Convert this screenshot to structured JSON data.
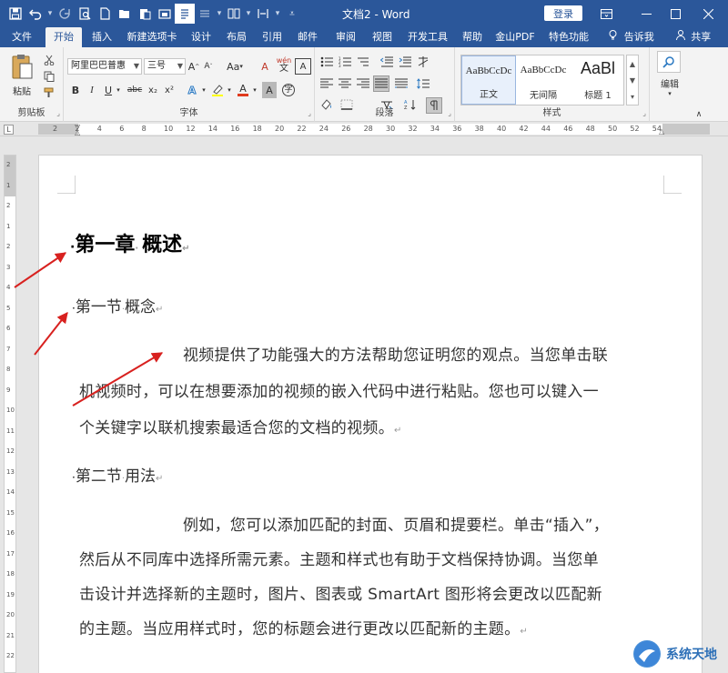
{
  "window": {
    "doc_title": "文档2 - Word",
    "login_label": "登录",
    "controls": [
      "ribbon-display",
      "minimize",
      "maximize",
      "close"
    ]
  },
  "quick_access": [
    "save",
    "undo",
    "redo",
    "print-preview",
    "new",
    "open",
    "paste",
    "screenshot",
    "read-mode",
    "layout",
    "columns",
    "spacing",
    "more"
  ],
  "tabs": [
    "文件",
    "开始",
    "插入",
    "新建选项卡",
    "设计",
    "布局",
    "引用",
    "邮件",
    "审阅",
    "视图",
    "开发工具",
    "帮助",
    "金山PDF",
    "特色功能",
    "告诉我",
    "共享"
  ],
  "active_tab": "开始",
  "ribbon": {
    "clipboard": {
      "label": "剪贴板",
      "paste": "粘贴"
    },
    "font": {
      "label": "字体",
      "font_name": "阿里巴巴普惠",
      "font_size": "三号",
      "buttons": [
        "B",
        "I",
        "U",
        "abc",
        "x₂",
        "x²",
        "A",
        "A",
        "A",
        "A"
      ],
      "change_case": "Aa",
      "clear_format": "A",
      "phonetic": "wén",
      "enclose": "A"
    },
    "paragraph": {
      "label": "段落"
    },
    "styles": {
      "label": "样式",
      "items": [
        {
          "preview": "AaBbCcDc",
          "name": "正文"
        },
        {
          "preview": "AaBbCcDc",
          "name": "无间隔"
        },
        {
          "preview": "AaBl",
          "name": "标题 1"
        }
      ]
    },
    "editing": {
      "label": "编辑"
    }
  },
  "ruler": {
    "corner": "L",
    "ticks": [
      "2",
      "2",
      "4",
      "6",
      "8",
      "10",
      "12",
      "14",
      "16",
      "18",
      "20",
      "22",
      "24",
      "26",
      "28",
      "30",
      "32",
      "34",
      "36",
      "38",
      "40",
      "42",
      "44",
      "46",
      "48",
      "50",
      "52",
      "54"
    ],
    "vticks": [
      "2",
      "1",
      "2",
      "1",
      "2",
      "3",
      "4",
      "5",
      "6",
      "7",
      "8",
      "9",
      "10",
      "11",
      "12",
      "13",
      "14",
      "15",
      "16",
      "17",
      "18",
      "19",
      "20",
      "21",
      "22"
    ]
  },
  "document": {
    "heading1": "第一章",
    "heading1_b": "概述",
    "section1": "第一节",
    "section1_b": "概念",
    "para1": [
      "视频提供了功能强大的方法帮助您证明您的观点。当您单击联",
      "机视频时，可以在想要添加的视频的嵌入代码中进行粘贴。您也可以键入一",
      "个关键字以联机搜索最适合您的文档的视频。"
    ],
    "section2": "第二节",
    "section2_b": "用法",
    "para2": [
      "例如，您可以添加匹配的封面、页眉和提要栏。单击“插入”，",
      "然后从不同库中选择所需元素。主题和样式也有助于文档保持协调。当您单",
      "击设计并选择新的主题时，图片、图表或 SmartArt 图形将会更改以匹配新",
      "的主题。当应用样式时，您的标题会进行更改以匹配新的主题。"
    ],
    "para_mark": "↵",
    "bullet": "·"
  },
  "watermark": {
    "text": "系统天地"
  },
  "colors": {
    "accent": "#2b579a",
    "arrow": "#d8211f",
    "page": "#ffffff"
  }
}
